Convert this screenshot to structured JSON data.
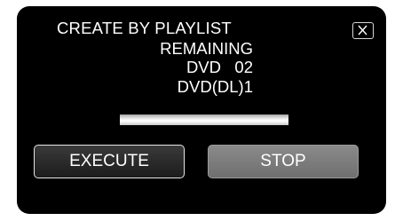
{
  "dialog": {
    "title": "CREATE BY PLAYLIST",
    "remaining_label": "REMAINING",
    "dvd_line": "DVD   02",
    "dvd_dl_line": "DVD(DL)1",
    "close_icon": "close-icon",
    "progress_fraction": 1.0
  },
  "buttons": {
    "execute_label": "EXECUTE",
    "stop_label": "STOP"
  },
  "colors": {
    "background": "#000000",
    "text": "#ffffff",
    "stop_button": "#7d7d7d"
  }
}
